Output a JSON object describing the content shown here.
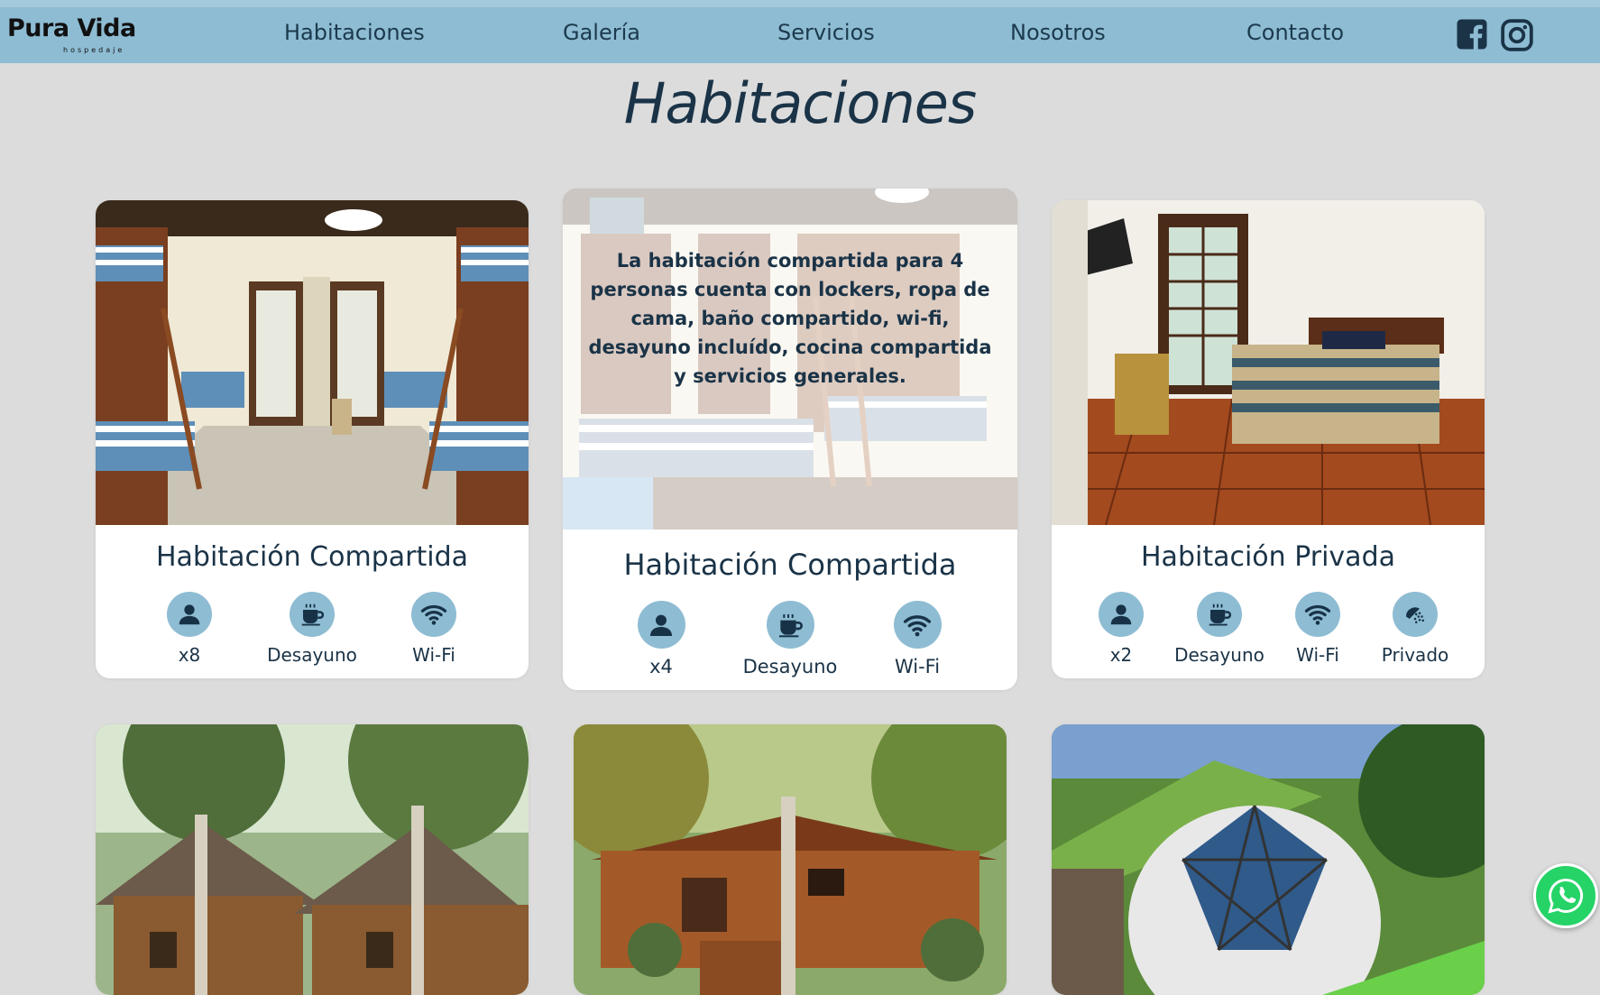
{
  "brand": {
    "name": "Pura Vida",
    "tagline": "hospedaje"
  },
  "nav": {
    "links": [
      "Habitaciones",
      "Galería",
      "Servicios",
      "Nosotros",
      "Contacto"
    ],
    "social": [
      "facebook-icon",
      "instagram-icon"
    ]
  },
  "page": {
    "title": "Habitaciones"
  },
  "rooms": [
    {
      "title": "Habitación Compartida",
      "image": "bunk-room-photo",
      "amenities": [
        {
          "icon": "person-icon",
          "label": "x8"
        },
        {
          "icon": "coffee-cup-icon",
          "label": "Desayuno"
        },
        {
          "icon": "wifi-icon",
          "label": "Wi-Fi"
        }
      ]
    },
    {
      "title": "Habitación Compartida",
      "image": "bunk-room-photo",
      "description": "La habitación compartida para 4 personas cuenta con lockers, ropa de cama, baño compartido, wi-fi, desayuno incluído, cocina compartida y servicios generales.",
      "amenities": [
        {
          "icon": "person-icon",
          "label": "x4"
        },
        {
          "icon": "coffee-cup-icon",
          "label": "Desayuno"
        },
        {
          "icon": "wifi-icon",
          "label": "Wi-Fi"
        }
      ]
    },
    {
      "title": "Habitación Privada",
      "image": "private-room-photo",
      "amenities": [
        {
          "icon": "person-icon",
          "label": "x2"
        },
        {
          "icon": "coffee-cup-icon",
          "label": "Desayuno"
        },
        {
          "icon": "wifi-icon",
          "label": "Wi-Fi"
        },
        {
          "icon": "shower-icon",
          "label": "Privado"
        }
      ]
    },
    {
      "image": "cabins-photo"
    },
    {
      "image": "cabin-porch-photo"
    },
    {
      "image": "glamping-dome-photo"
    }
  ],
  "colors": {
    "nav": "#8ebcd3",
    "accent": "#8ebcd3",
    "text": "#1a3347",
    "background": "#dcdcdc",
    "whatsapp": "#25d366"
  },
  "floating": {
    "icon": "whatsapp-icon"
  }
}
